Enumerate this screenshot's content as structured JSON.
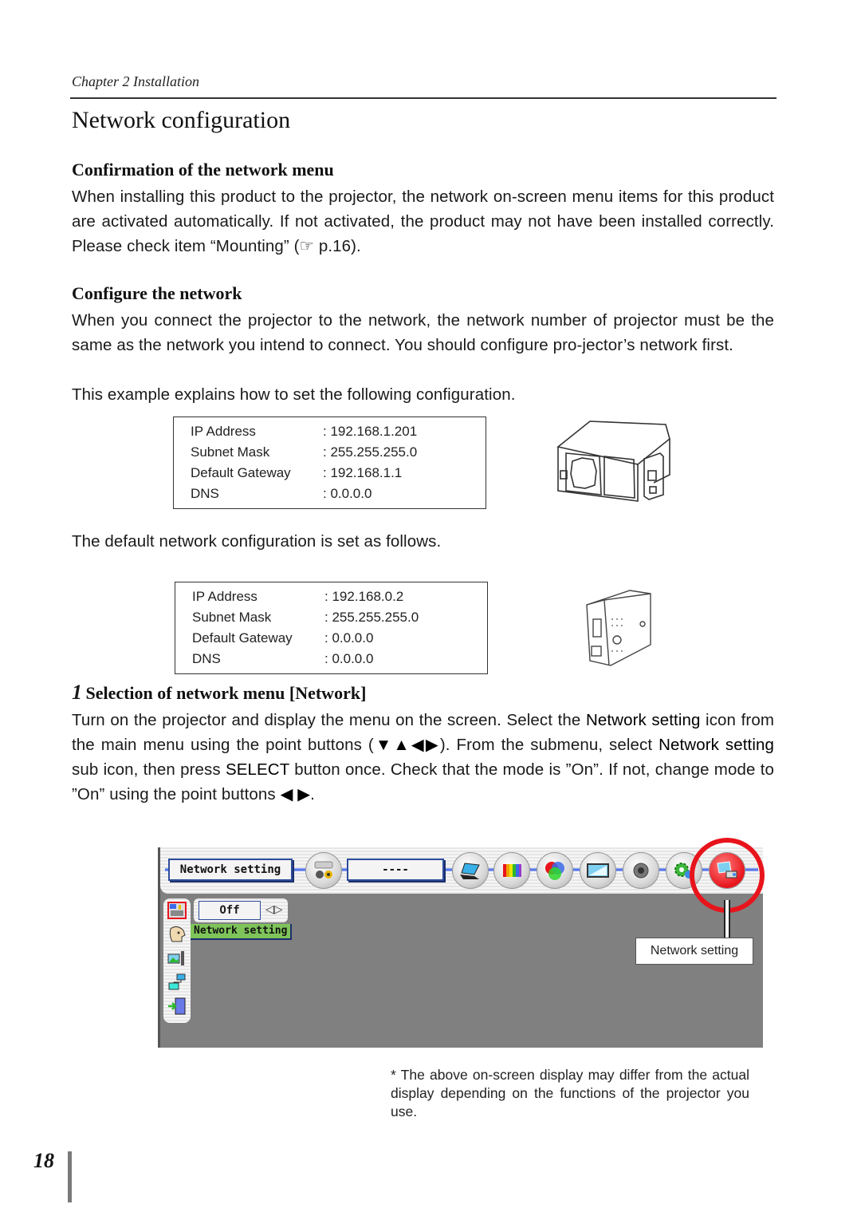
{
  "header": {
    "chapter": "Chapter 2 Installation"
  },
  "page_title": "Network configuration",
  "section_confirm": {
    "heading": "Confirmation of the network menu",
    "body": "When installing this product to the projector, the network on-screen menu items for this product are activated automatically. If not activated, the product may not have been installed correctly. Please check item “Mounting” (☞ p.16)."
  },
  "section_configure": {
    "heading": "Configure the network",
    "body_lines": [
      "When you connect the projector to the network, the network number of projector must be the same as the network you intend to connect. You should configure pro-jector’s network first.",
      "This example explains how to set the following configuration."
    ]
  },
  "example_config": {
    "rows": [
      {
        "label": "IP Address",
        "value": ": 192.168.1.201"
      },
      {
        "label": "Subnet Mask",
        "value": ": 255.255.255.0"
      },
      {
        "label": "Default Gateway",
        "value": ": 192.168.1.1"
      },
      {
        "label": "DNS",
        "value": ": 0.0.0.0"
      }
    ],
    "illustration": "projector-illustration"
  },
  "default_intro": "The default network configuration is set as follows.",
  "default_config": {
    "rows": [
      {
        "label": "IP Address",
        "value": ": 192.168.0.2"
      },
      {
        "label": "Subnet Mask",
        "value": ": 255.255.255.0"
      },
      {
        "label": "Default Gateway",
        "value": ": 0.0.0.0"
      },
      {
        "label": "DNS",
        "value": ": 0.0.0.0"
      }
    ],
    "illustration": "network-unit-illustration"
  },
  "step1": {
    "number": "1",
    "heading": "Selection of network menu [Network]",
    "body_parts": {
      "p1": "Turn on the projector and display the menu on the screen. Select the ",
      "b1": "Network setting",
      "p2": " icon from the main menu using the point buttons (",
      "arrows": "▼▲◀▶",
      "p3": "). From the submenu, select ",
      "b2": "Network setting",
      "p4": " sub icon, then press ",
      "b3": "SELECT",
      "p5": " button once. Check that the mode is ”On”. If not, change mode to ”On” using the point buttons ",
      "arrows2": "◀ ▶",
      "p6": "."
    }
  },
  "osd": {
    "menu_title": "Network setting",
    "input_value": "----",
    "main_icons": [
      "input-icon",
      "pc-adjust-icon",
      "image-select-icon",
      "image-adjust-icon",
      "screen-icon",
      "sound-icon",
      "setting-icon",
      "network-setting-icon"
    ],
    "side_icons": [
      "network-setting-sub-icon",
      "face-icon",
      "picture-icon",
      "network-pc-icon",
      "exit-icon"
    ],
    "mode_value": "Off",
    "tooltip": "Network setting",
    "highlight_color": "#e8141c",
    "callout_label": "Network setting"
  },
  "note": "* The above on-screen display may differ from the actual display depending on the functions of the projector you use.",
  "page_number": "18"
}
